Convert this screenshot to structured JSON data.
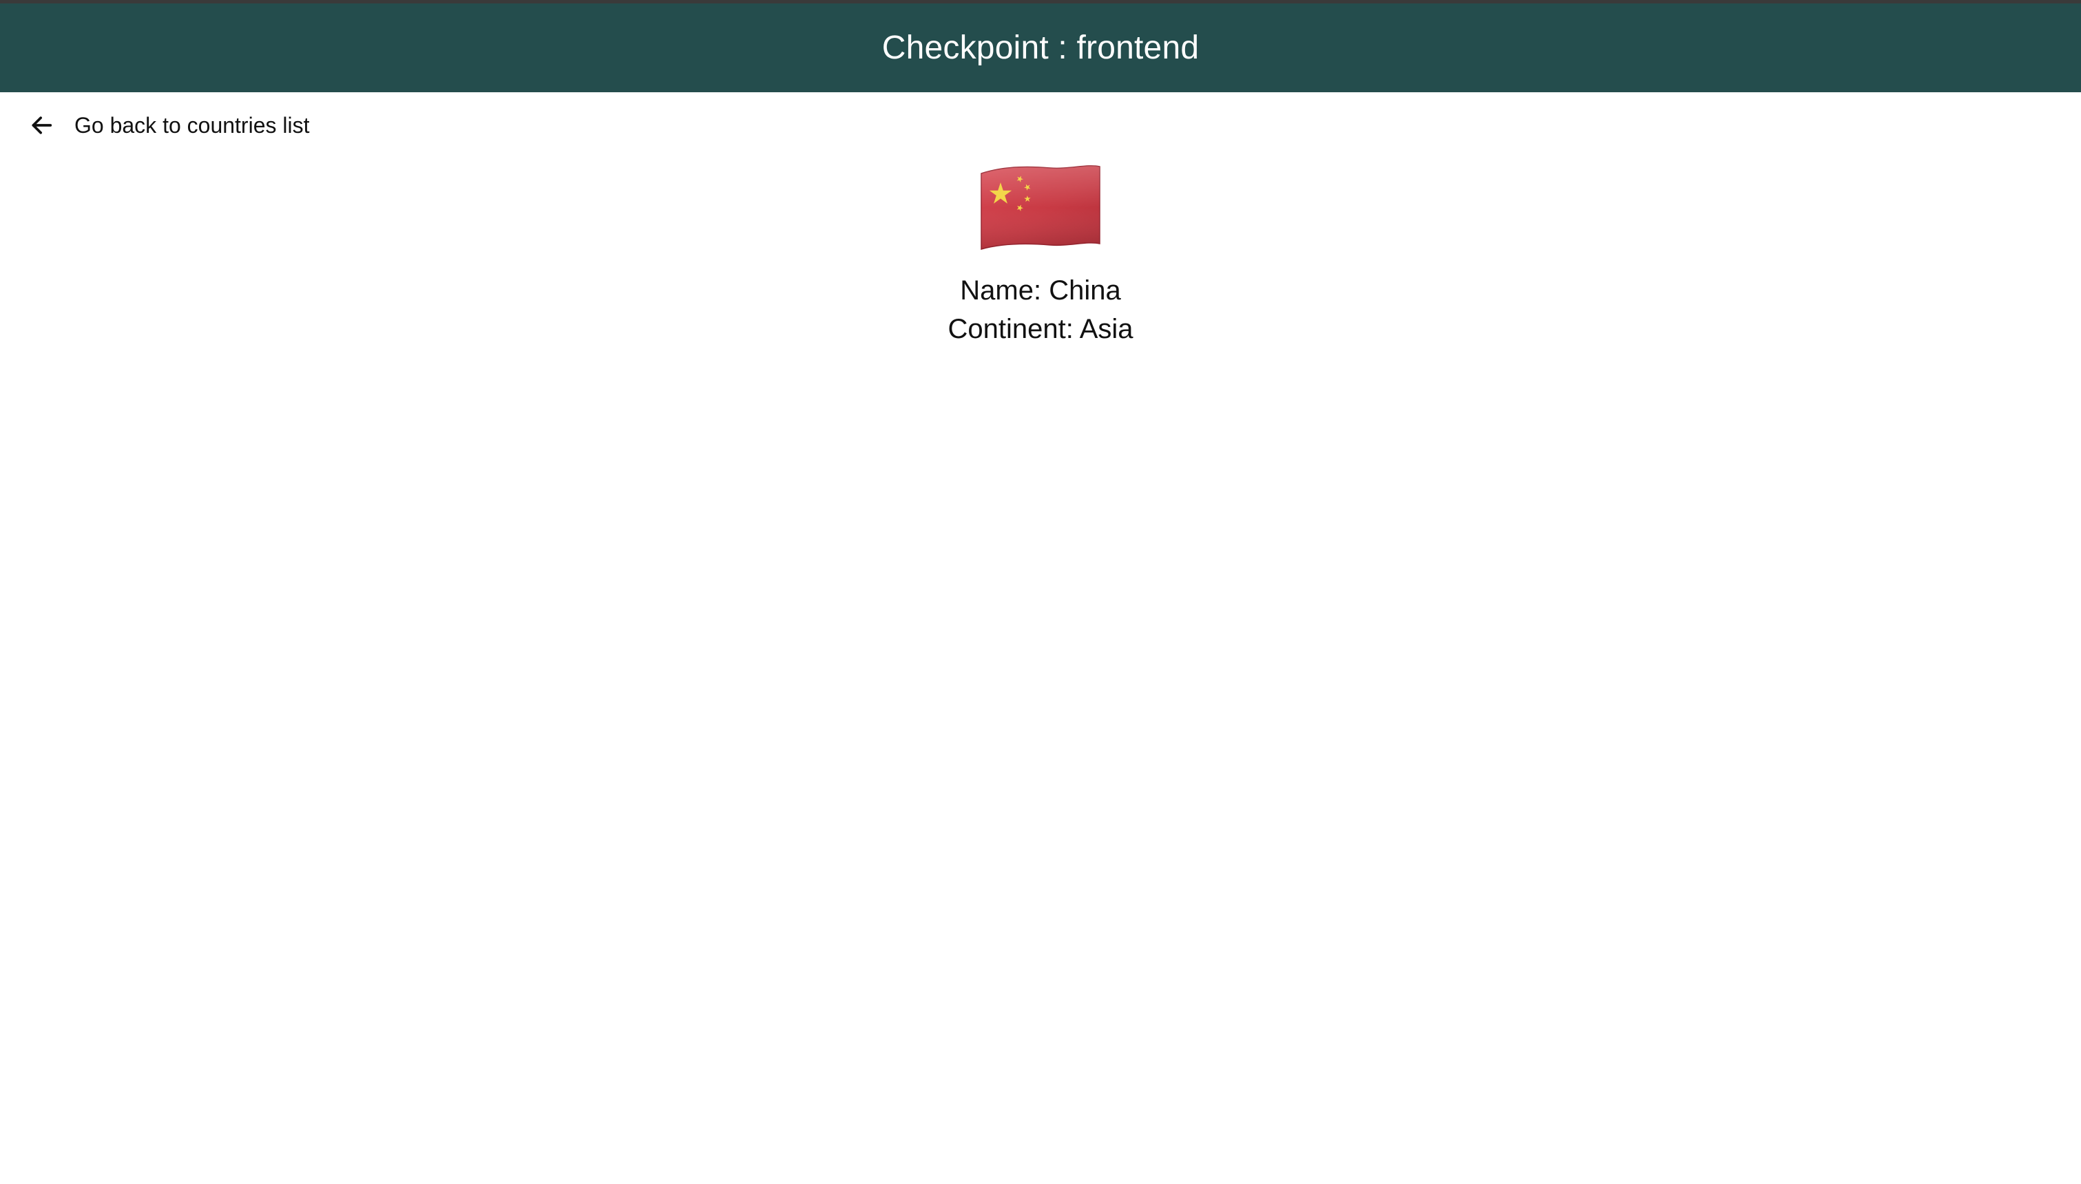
{
  "header": {
    "title": "Checkpoint : frontend",
    "background_color": "#244d4d",
    "text_color": "#ffffff"
  },
  "nav": {
    "back_label": "Go back to countries list",
    "back_icon": "arrow-left-icon"
  },
  "country": {
    "flag_icon": "china-flag-icon",
    "flag_colors": {
      "field": "#cf3c45",
      "stars": "#f3d64a"
    },
    "name_line": "Name: China",
    "continent_line": "Continent: Asia"
  }
}
